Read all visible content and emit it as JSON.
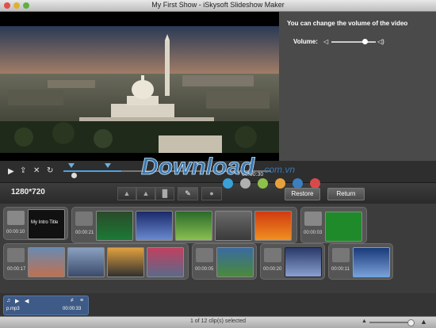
{
  "window": {
    "title": "My First Show - iSkysoft Slideshow Maker"
  },
  "panel": {
    "message": "You can change the volume of the video",
    "volume_label": "Volume:",
    "volume_level": 0.75
  },
  "player": {
    "timecode": "00:00:30",
    "progress": 0.28,
    "play_icon": "play-icon",
    "export_icon": "export-icon",
    "cut_icon": "scissors-icon",
    "rotate_icon": "rotate-icon"
  },
  "toolbar": {
    "resolution": "1280*720",
    "restore_label": "Restore",
    "return_label": "Return",
    "colors": [
      "#3aa0d8",
      "#b0b0b0",
      "#8cc04a",
      "#e8a13a",
      "#3a7fc0",
      "#d84a4a"
    ]
  },
  "storyboard": {
    "row1": [
      {
        "time": "00:00:10",
        "label": "My Intro Title"
      },
      {
        "time": "00:00:21"
      },
      {
        "time": "00:00:03"
      }
    ],
    "row2": [
      {
        "time": "00:00:17"
      },
      {
        "time": "00:00:05"
      },
      {
        "time": "00:00:20"
      },
      {
        "time": "00:00:11"
      }
    ]
  },
  "audio": {
    "filename": "p.mp3",
    "time": "00:00:33"
  },
  "status": {
    "text": "1 of 12 clip(s) selected"
  },
  "watermark": {
    "main": "Download",
    "suffix": ".com.vn"
  }
}
